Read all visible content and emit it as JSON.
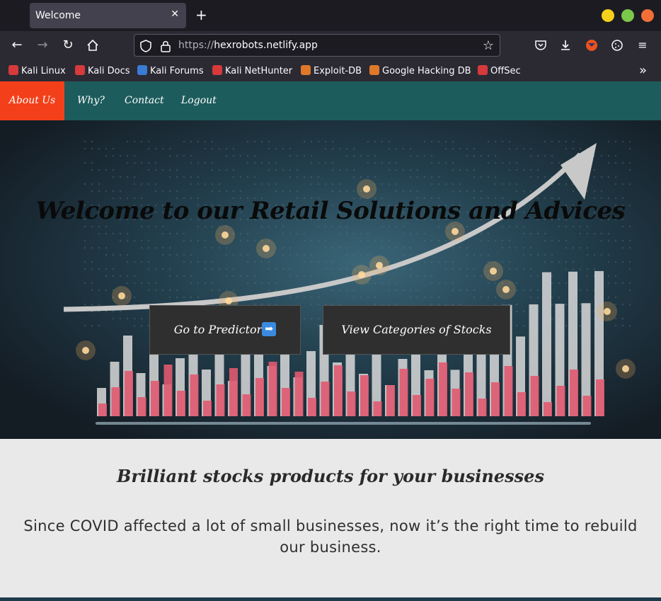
{
  "browser": {
    "tab_title": "Welcome",
    "url_scheme": "https://",
    "url_host": "hexrobots.netlify.app",
    "bookmarks": [
      {
        "label": "Kali Linux",
        "color": "#e8e8e8"
      },
      {
        "label": "Kali Docs",
        "color": "#d63a3a"
      },
      {
        "label": "Kali Forums",
        "color": "#3a7bd6"
      },
      {
        "label": "Kali NetHunter",
        "color": "#e8e8e8"
      },
      {
        "label": "Exploit-DB",
        "color": "#e0782a"
      },
      {
        "label": "Google Hacking DB",
        "color": "#e0782a"
      },
      {
        "label": "OffSec",
        "color": "#d63a3a"
      }
    ]
  },
  "site": {
    "nav": {
      "about": "About Us",
      "why": "Why?",
      "contact": "Contact",
      "logout": "Logout"
    },
    "hero": {
      "title": "Welcome to our Retail Solutions and Advices",
      "predictor_button": "Go to Predictor",
      "predictor_icon": "➡",
      "categories_button": "View Categories of Stocks"
    },
    "info": {
      "title": "Brilliant stocks products for your businesses",
      "text": "Since COVID affected a lot of small businesses, now it’s the right time to rebuild our business."
    }
  },
  "colors": {
    "nav_bg": "#1d5c5d",
    "nav_active": "#f3401a",
    "button_bg": "#2f2f2f",
    "info_bg": "#e9e9e9"
  }
}
